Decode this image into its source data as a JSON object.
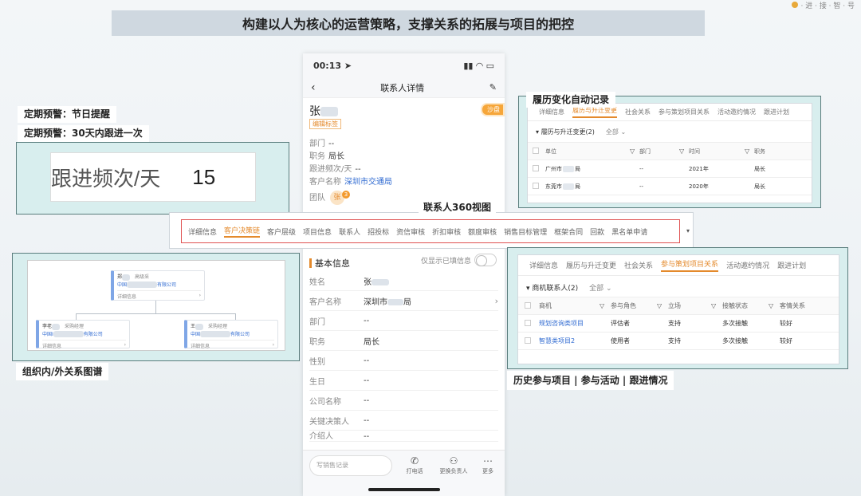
{
  "banner": {
    "title": "构建以人为核心的运营策略，支撑关系的拓展与项目的把控"
  },
  "left": {
    "tag_holiday": "定期预警：节日提醒",
    "tag_followup": "定期预警：30天内跟进一次",
    "freq_label": "跟进频次/天",
    "freq_value": "15",
    "org_caption": "组织内/外关系图谱",
    "org": {
      "top": {
        "name": "郑",
        "title": "高级采",
        "company_start": "中国",
        "company_end": "有限公司",
        "footer": "详细信息"
      },
      "left": {
        "name": "李老",
        "title": "采购经理",
        "company_start": "中国I",
        "company_end": "有限公司",
        "footer": "详细信息"
      },
      "right": {
        "name": "王",
        "title": "采购经理",
        "company_start": "中国",
        "company_end": "有限公司",
        "footer": "详细信息"
      },
      "chevron": "›"
    }
  },
  "phone": {
    "time": "00:13",
    "title": "联系人详情",
    "name": "张",
    "edit_tag": "编辑标签",
    "badge": "沙盘",
    "rows": {
      "dept_label": "部门",
      "dept_value": "--",
      "role_label": "职务",
      "role_value": "局长",
      "freq_label": "跟进频次/天",
      "freq_value": "--",
      "cust_label": "客户名称",
      "cust_value": "深圳市交通局",
      "team_label": "团队",
      "team_avatar": "张",
      "team_count": "3"
    },
    "basic_title": "基本信息",
    "only_filled": "仅显示已填信息",
    "fields": [
      {
        "k": "姓名",
        "v": "张"
      },
      {
        "k": "客户名称",
        "v": "深圳市",
        "v_end": "局",
        "arrow": "›"
      },
      {
        "k": "部门",
        "v": "--"
      },
      {
        "k": "职务",
        "v": "局长"
      },
      {
        "k": "性别",
        "v": "--"
      },
      {
        "k": "生日",
        "v": "--"
      },
      {
        "k": "公司名称",
        "v": "--"
      },
      {
        "k": "关键决策人",
        "v": "--"
      },
      {
        "k": "介绍人",
        "v": "--"
      }
    ],
    "bottom": {
      "memo": "写销售记录",
      "call": "打电话",
      "change": "更换负责人",
      "more": "更多"
    }
  },
  "tabstrip": {
    "title": "联系人360视图",
    "tabs": [
      "详细信息",
      "客户决策链",
      "客户层级",
      "项目信息",
      "联系人",
      "招投标",
      "资信审核",
      "折扣审核",
      "额度审核",
      "销售目标管理",
      "框架合同",
      "回款",
      "黑名单申请"
    ],
    "active": 1,
    "arrow": "▾"
  },
  "resume": {
    "title": "履历变化自动记录",
    "tabs": [
      "详细信息",
      "履历与升迁变更",
      "社会关系",
      "参与策划项目关系",
      "活动邀约情况",
      "跟进计划"
    ],
    "active": 1,
    "section": "履历与升迁变更(2)",
    "all": "全部",
    "headers": [
      "单位",
      "部门",
      "时间",
      "职务"
    ],
    "rows": [
      {
        "unit_start": "广州市",
        "unit_end": "局",
        "dept": "--",
        "time": "2021年",
        "role": "局长"
      },
      {
        "unit_start": "东莞市",
        "unit_end": "局",
        "dept": "--",
        "time": "2020年",
        "role": "局长"
      }
    ]
  },
  "projects": {
    "caption": "历史参与项目 | 参与活动 | 跟进情况",
    "tabs": [
      "详细信息",
      "履历与升迁变更",
      "社会关系",
      "参与策划项目关系",
      "活动邀约情况",
      "跟进计划"
    ],
    "active": 3,
    "section": "商机联系人(2)",
    "all": "全部",
    "headers": [
      "商机",
      "参与角色",
      "立场",
      "接触状态",
      "客情关系"
    ],
    "rows": [
      {
        "opp": "规划咨询类项目",
        "role": "评估者",
        "stance": "支持",
        "contact": "多次接触",
        "rel": "较好"
      },
      {
        "opp": "智慧类项目2",
        "role": "使用者",
        "stance": "支持",
        "contact": "多次接触",
        "rel": "较好"
      }
    ]
  },
  "corner": {
    "text": "· 进 · 接 · 智 · 号"
  },
  "colors": {
    "accent": "#e48a2c",
    "link": "#2f6ad1",
    "frame": "#d8eeee",
    "highlight": "#e05252"
  }
}
